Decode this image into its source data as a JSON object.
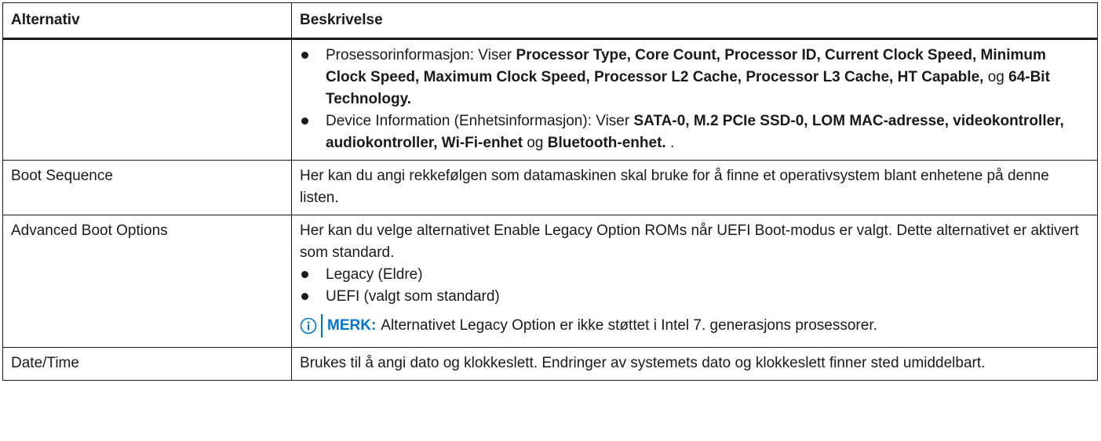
{
  "header": {
    "col1": "Alternativ",
    "col2": "Beskrivelse"
  },
  "row_sysinfo": {
    "items": [
      {
        "lead": "Prosessorinformasjon: Viser ",
        "bold": "Processor Type, Core Count, Processor ID, Current Clock Speed, Minimum Clock Speed, Maximum Clock Speed, Processor L2 Cache, Processor L3 Cache, HT Capable,",
        "mid": " og ",
        "bold2": "64-Bit Technology.",
        "tail": ""
      },
      {
        "lead": "Device Information (Enhetsinformasjon): Viser ",
        "bold": "SATA-0, M.2 PCIe SSD-0, LOM MAC-adresse, videokontroller, audiokontroller, Wi-Fi-enhet",
        "mid": " og ",
        "bold2": "Bluetooth-enhet.",
        "tail": " ."
      }
    ]
  },
  "row_boot_sequence": {
    "option": "Boot Sequence",
    "description": "Her kan du angi rekkefølgen som datamaskinen skal bruke for å finne et operativsystem blant enhetene på denne listen."
  },
  "row_advanced_boot": {
    "option": "Advanced Boot Options",
    "description": "Her kan du velge alternativet Enable Legacy Option ROMs når UEFI Boot-modus er valgt. Dette alternativet er aktivert som standard.",
    "bullets": [
      "Legacy (Eldre)",
      "UEFI (valgt som standard)"
    ],
    "note_label": "MERK:",
    "note_text": "Alternativet Legacy Option er ikke støttet i Intel 7. generasjons prosessorer.",
    "note_icon": "info-circle-icon",
    "note_color": "#0076ce"
  },
  "row_date_time": {
    "option": "Date/Time",
    "description": "Brukes til å angi dato og klokkeslett. Endringer av systemets dato og klokkeslett finner sted umiddelbart."
  }
}
